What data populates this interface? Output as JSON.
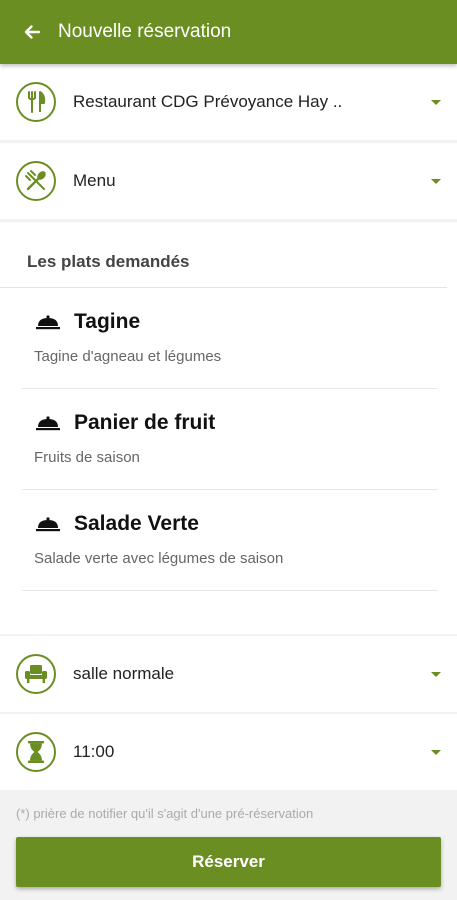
{
  "appbar": {
    "title": "Nouvelle réservation"
  },
  "restaurant": {
    "value": "Restaurant CDG Prévoyance Hay ..",
    "icon": "fork-knife-icon"
  },
  "menu": {
    "value": "Menu",
    "icon": "spoon-fork-icon"
  },
  "plats": {
    "header": "Les plats demandés",
    "items": [
      {
        "name": "Tagine",
        "description": "Tagine d'agneau et légumes"
      },
      {
        "name": "Panier de fruit",
        "description": "Fruits de saison"
      },
      {
        "name": "Salade Verte",
        "description": "Salade verte avec légumes de saison"
      }
    ]
  },
  "salle": {
    "value": "salle normale",
    "icon": "armchair-icon"
  },
  "heure": {
    "value": "11:00",
    "icon": "hourglass-icon"
  },
  "footnote": "(*) prière de notifier qu'il s'agit d'une pré-réservation",
  "reserve_label": "Réserver",
  "colors": {
    "accent": "#6b8e23",
    "background": "#f2f2f2"
  }
}
